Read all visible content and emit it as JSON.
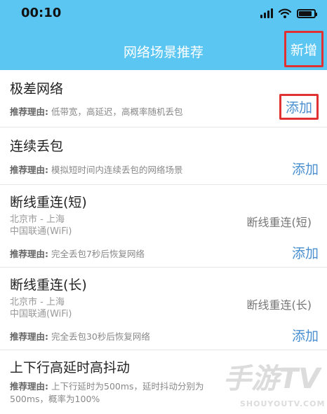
{
  "status": {
    "time": "00:10",
    "battery_level": 0.85
  },
  "nav": {
    "title": "网络场景推荐",
    "new_label": "新增"
  },
  "items": [
    {
      "title": "极差网络",
      "reason_label": "推荐理由:",
      "reason": "低带宽，高延迟，高概率随机丢包",
      "add_label": "添加"
    },
    {
      "title": "连续丢包",
      "reason_label": "推荐理由:",
      "reason": "模拟短时间内连续丢包的网络场景",
      "add_label": "添加"
    },
    {
      "title": "断线重连(短)",
      "location": "北京市 - 上海",
      "carrier": "中国联通(WiFi)",
      "scene": "断线重连(短)",
      "reason_label": "推荐理由:",
      "reason": "完全丢包7秒后恢复网络",
      "add_label": "添加"
    },
    {
      "title": "断线重连(长)",
      "location": "北京市 - 上海",
      "carrier": "中国联通(WiFi)",
      "scene": "断线重连(长)",
      "reason_label": "推荐理由:",
      "reason": "完全丢包30秒后恢复网络",
      "add_label": "添加"
    },
    {
      "title": "上下行高延时高抖动",
      "reason_label": "推荐理由:",
      "reason": "上下行延时为500ms，延时抖动分别为",
      "reason_line2": "500ms，概率为100%",
      "add_label": "添加"
    }
  ],
  "watermark": {
    "main": "手游TV",
    "sub": "SHOUYOUTV.COM"
  }
}
